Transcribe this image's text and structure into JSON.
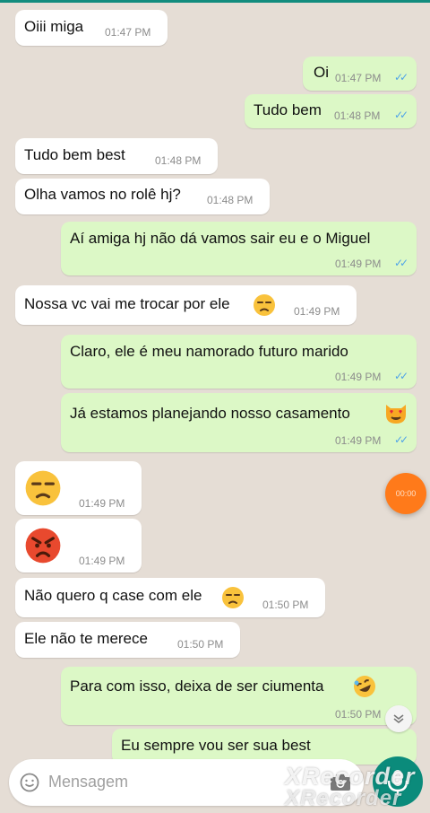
{
  "messages": [
    {
      "text": "Oiii miga",
      "time": "01:47 PM"
    },
    {
      "text": "Oi",
      "time": "01:47 PM"
    },
    {
      "text": "Tudo bem",
      "time": "01:48 PM"
    },
    {
      "text": "Tudo bem best",
      "time": "01:48 PM"
    },
    {
      "text": "Olha vamos no rolê hj?",
      "time": "01:48 PM"
    },
    {
      "text": "Aí amiga hj não dá vamos sair eu e o Miguel",
      "time": "01:49 PM"
    },
    {
      "text": "Nossa vc vai me trocar por ele",
      "time": "01:49 PM"
    },
    {
      "text": "Claro, ele é meu namorado futuro marido",
      "time": "01:49 PM"
    },
    {
      "text": "Já estamos planejando nosso casamento",
      "time": "01:49 PM"
    },
    {
      "text": "",
      "time": "01:49 PM"
    },
    {
      "text": "",
      "time": "01:49 PM"
    },
    {
      "text": "Não quero q case com ele",
      "time": "01:50 PM"
    },
    {
      "text": "Ele não te merece",
      "time": "01:50 PM"
    },
    {
      "text": "Para com isso, deixa de ser ciumenta",
      "time": "01:50 PM"
    },
    {
      "text": "Eu sempre vou ser sua best",
      "time": ""
    }
  ],
  "composer": {
    "placeholder": "Mensagem"
  },
  "recorder": {
    "time": "00:00"
  },
  "watermark": {
    "line1": "XRecorder",
    "line2": "XRecorder"
  },
  "colors": {
    "incoming": "#ffffff",
    "outgoing": "#dcf8c6",
    "ticks": "#4fa3e8",
    "mic": "#0b8b7b",
    "record": "#ff7a1a"
  },
  "icons": [
    "double-check-icon",
    "unamused-face-icon",
    "angry-face-icon",
    "heart-eyes-cat-icon",
    "rofl-face-icon",
    "emoji-icon",
    "camera-icon",
    "mic-icon",
    "chevron-down-icon"
  ]
}
